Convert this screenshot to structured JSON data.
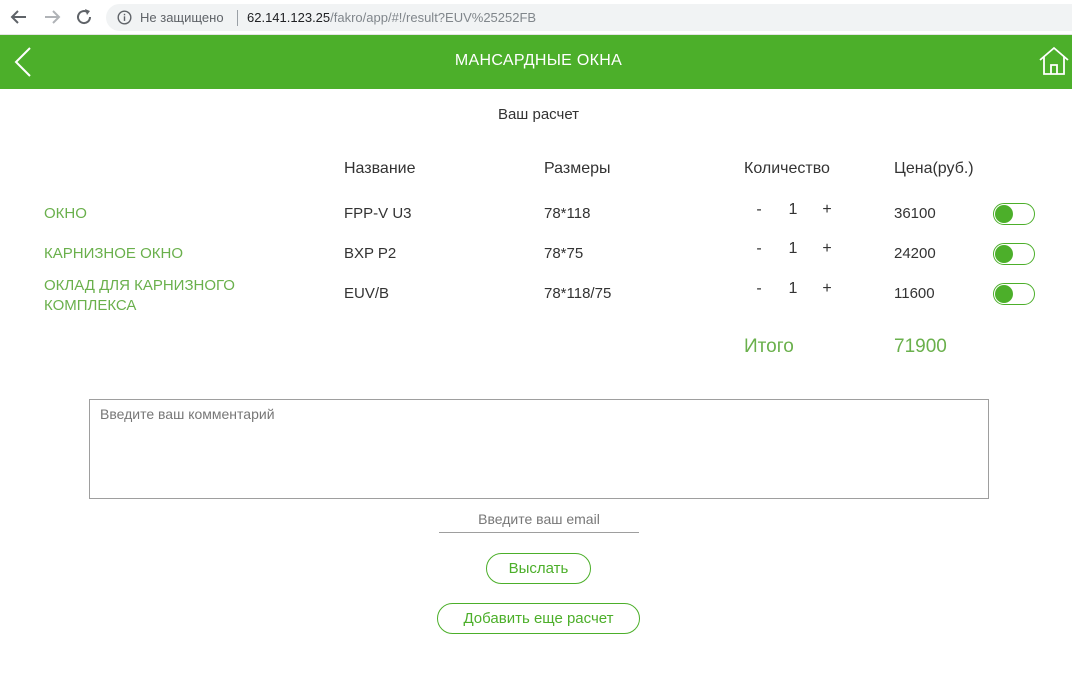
{
  "browser": {
    "security_label": "Не защищено",
    "url_host": "62.141.123.25",
    "url_path": "/fakro/app/#!/result?EUV%25252FB"
  },
  "header": {
    "title": "МАНСАРДНЫЕ ОКНА",
    "color": "#4caf2a"
  },
  "page": {
    "subtitle": "Ваш расчет"
  },
  "table": {
    "columns": {
      "name": "Название",
      "size": "Размеры",
      "quantity": "Количество",
      "price": "Цена(руб.)"
    },
    "rows": [
      {
        "title": "ОКНО",
        "model": "FPP-V U3",
        "size": "78*118",
        "minus": "-",
        "quantity": "1",
        "plus": "+",
        "price": "36100",
        "enabled": true
      },
      {
        "title": "КАРНИЗНОЕ ОКНО",
        "model": "BXP P2",
        "size": "78*75",
        "minus": "-",
        "quantity": "1",
        "plus": "+",
        "price": "24200",
        "enabled": true
      },
      {
        "title": "ОКЛАД ДЛЯ КАРНИЗНОГО КОМПЛЕКСА",
        "model": "EUV/B",
        "size": "78*118/75",
        "minus": "-",
        "quantity": "1",
        "plus": "+",
        "price": "11600",
        "enabled": true
      }
    ]
  },
  "total": {
    "label": "Итого",
    "value": "71900"
  },
  "form": {
    "comment_placeholder": "Введите ваш комментарий",
    "email_placeholder": "Введите ваш email",
    "send_label": "Выслать",
    "add_label": "Добавить еще расчет"
  },
  "icons": {
    "back": "arrow-left-icon",
    "forward": "arrow-right-icon",
    "reload": "reload-icon",
    "info": "info-icon",
    "header_back": "chevron-left-icon",
    "header_home": "home-icon"
  }
}
